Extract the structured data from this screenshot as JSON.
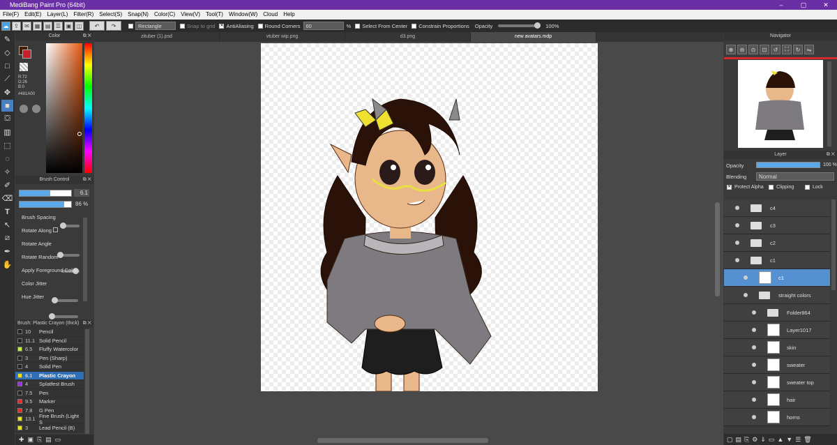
{
  "app": {
    "title": "MediBang Paint Pro (64bit)",
    "window_controls": [
      "–",
      "▢",
      "✕"
    ]
  },
  "menu": [
    "File(F)",
    "Edit(E)",
    "Layer(L)",
    "Filter(R)",
    "Select(S)",
    "Snap(N)",
    "Color(C)",
    "View(V)",
    "Tool(T)",
    "Window(W)",
    "Cloud",
    "Help"
  ],
  "toolbar": {
    "shape": "Rectangle",
    "snap_to_grid": "Snap to grid",
    "antialiasing": "AntiAliasing",
    "round_corners": "Round Corners",
    "round_value": "60",
    "round_unit": "%",
    "select_from_center": "Select From Center",
    "constrain_proportions": "Constrain Proportions",
    "opacity_label": "Opacity",
    "opacity_value": "100%"
  },
  "tabs": [
    "zituber (1).psd",
    "vtuber wip.png",
    "d3.png",
    "new avatars.mdp"
  ],
  "color_panel": {
    "title": "Color",
    "r": "R:72",
    "g": "G:26",
    "b": "B:0",
    "hex": "#481A00",
    "fg": "#481a00",
    "bg": "#c8202a"
  },
  "brush_control": {
    "title": "Brush Control",
    "size": "6.1",
    "opacity": "86",
    "opacity_unit": "%",
    "size_level": 0.6,
    "opacity_level": 0.86,
    "params": [
      "Brush Spacing",
      "Rotate Along",
      "Rotate Angle",
      "Rotate Random",
      "Apply Foreground Color",
      "Color Jitter",
      "Hue Jitter"
    ]
  },
  "brush_list": {
    "title": "Brush: Plastic Crayon (thick)",
    "items": [
      {
        "size": "10",
        "name": "Pencil",
        "color": "#222222"
      },
      {
        "size": "11.1",
        "name": "Solid Pencil",
        "color": "#222222"
      },
      {
        "size": "6.5",
        "name": "Fluffy Watercolor",
        "color": "#c5e84a"
      },
      {
        "size": "3",
        "name": "Pen (Sharp)",
        "color": "#222222"
      },
      {
        "size": "4",
        "name": "Solid Pen",
        "color": "#222222"
      },
      {
        "size": "6.1",
        "name": "Plastic Crayon",
        "color": "#e8e020"
      },
      {
        "size": "4",
        "name": "Splatfest Brush",
        "color": "#9b30e0"
      },
      {
        "size": "7.5",
        "name": "Pen",
        "color": "#222222"
      },
      {
        "size": "9.5",
        "name": "Marker",
        "color": "#e03030"
      },
      {
        "size": "7.8",
        "name": "G Pen",
        "color": "#e03030"
      },
      {
        "size": "13.1",
        "name": "Fine Brush (Light S",
        "color": "#e8e020"
      },
      {
        "size": "3",
        "name": "Lead Pencil (B)",
        "color": "#e8e020"
      }
    ]
  },
  "navigator": {
    "title": "Navigator"
  },
  "layer_panel": {
    "title": "Layer",
    "opacity_label": "Opacity",
    "opacity_value": "100 %",
    "opacity_level": 1.0,
    "blending_label": "Blending",
    "blending_value": "Normal",
    "protect_alpha": "Protect Alpha",
    "clipping": "Clipping",
    "lock": "Lock",
    "layers": [
      {
        "name": "c4",
        "type": "folder",
        "indent": 0
      },
      {
        "name": "c3",
        "type": "folder",
        "indent": 0
      },
      {
        "name": "c2",
        "type": "folder",
        "indent": 0
      },
      {
        "name": "c1",
        "type": "folder",
        "indent": 0
      },
      {
        "name": "c1",
        "type": "layer",
        "indent": 1,
        "selected": true
      },
      {
        "name": "straight colors",
        "type": "folder",
        "indent": 1
      },
      {
        "name": "Folder864",
        "type": "folder",
        "indent": 2
      },
      {
        "name": "Layer1017",
        "type": "layer",
        "indent": 2
      },
      {
        "name": "skin",
        "type": "layer",
        "indent": 2
      },
      {
        "name": "sweater",
        "type": "layer",
        "indent": 2
      },
      {
        "name": "sweater top",
        "type": "layer",
        "indent": 2
      },
      {
        "name": "hair",
        "type": "layer",
        "indent": 2
      },
      {
        "name": "horns",
        "type": "layer",
        "indent": 2
      }
    ]
  }
}
